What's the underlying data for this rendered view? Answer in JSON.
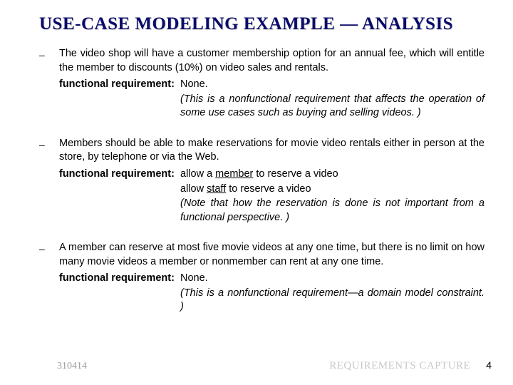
{
  "title": "USE-CASE MODELING EXAMPLE — ANALYSIS",
  "items": [
    {
      "text": "The video shop will have a customer membership option for an annual fee, which will entitle the member to discounts (10%) on video sales and rentals.",
      "req_label": "functional requirement:",
      "req_lines": [
        {
          "t": "None.",
          "italic": false
        },
        {
          "t": "(This is a nonfunctional requirement that affects the operation of some use cases such as buying and selling videos. )",
          "italic": true
        }
      ]
    },
    {
      "text": "Members should be able to make reservations for movie video rentals either in person at the store, by telephone or via the Web.",
      "req_label": "functional requirement:",
      "req_lines": [
        {
          "segments": [
            {
              "t": "allow a "
            },
            {
              "t": "member",
              "ul": true
            },
            {
              "t": " to reserve a video"
            }
          ]
        },
        {
          "segments": [
            {
              "t": "allow "
            },
            {
              "t": "staff",
              "ul": true
            },
            {
              "t": " to reserve a video"
            }
          ]
        },
        {
          "t": "(Note that how the reservation is done is not important from a functional perspective. )",
          "italic": true
        }
      ]
    },
    {
      "text": "A member can reserve at most five movie videos at any one time, but there is no limit on how many movie videos a member or nonmember can rent at any one time.",
      "req_label": "functional requirement:",
      "req_lines": [
        {
          "t": "None.",
          "italic": false
        },
        {
          "t": "(This is a nonfunctional requirement—a domain model constraint. )",
          "italic": true
        }
      ]
    }
  ],
  "footer": {
    "date": "310414",
    "caption": "REQUIREMENTS CAPTURE",
    "page": "4"
  }
}
